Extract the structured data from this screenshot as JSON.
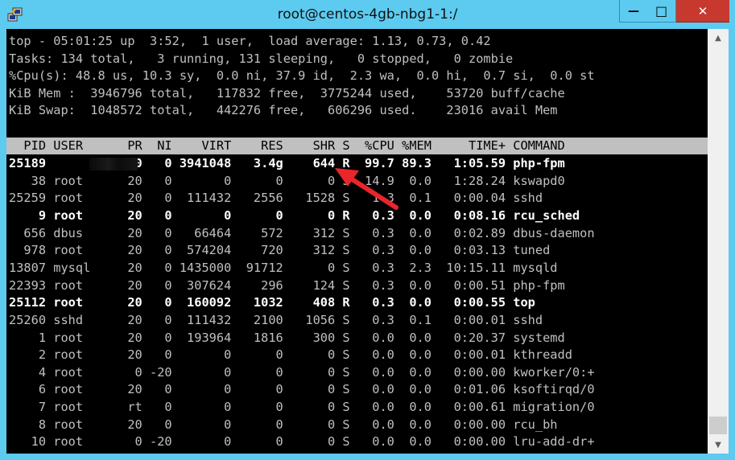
{
  "window": {
    "title": "root@centos-4gb-nbg1-1:/",
    "min_glyph": "—",
    "max_glyph": "□",
    "close_glyph": "✕"
  },
  "top_summary": [
    "top - 05:01:25 up  3:52,  1 user,  load average: 1.13, 0.73, 0.42",
    "Tasks: 134 total,   3 running, 131 sleeping,   0 stopped,   0 zombie",
    "%Cpu(s): 48.8 us, 10.3 sy,  0.0 ni, 37.9 id,  2.3 wa,  0.0 hi,  0.7 si,  0.0 st",
    "KiB Mem :  3946796 total,   117832 free,  3775244 used,    53720 buff/cache",
    "KiB Swap:  1048572 total,   442276 free,   606296 used.    23016 avail Mem"
  ],
  "process_header": "  PID USER      PR  NI    VIRT    RES    SHR S  %CPU %MEM     TIME+ COMMAND",
  "processes": [
    {
      "text": "25189           20   0 3941048   3.4g    644 R  99.7 89.3   1:05.59 php-fpm",
      "bold": true
    },
    {
      "text": "   38 root      20   0       0      0      0 S  14.9  0.0   1:28.24 kswapd0",
      "bold": false
    },
    {
      "text": "25259 root      20   0  111432   2556   1528 S   1.3  0.1   0:00.04 sshd",
      "bold": false
    },
    {
      "text": "    9 root      20   0       0      0      0 R   0.3  0.0   0:08.16 rcu_sched",
      "bold": true
    },
    {
      "text": "  656 dbus      20   0   66464    572    312 S   0.3  0.0   0:02.89 dbus-daemon",
      "bold": false
    },
    {
      "text": "  978 root      20   0  574204    720    312 S   0.3  0.0   0:03.13 tuned",
      "bold": false
    },
    {
      "text": "13807 mysql     20   0 1435000  91712      0 S   0.3  2.3  10:15.11 mysqld",
      "bold": false
    },
    {
      "text": "22393 root      20   0  307624    296    124 S   0.3  0.0   0:00.51 php-fpm",
      "bold": false
    },
    {
      "text": "25112 root      20   0  160092   1032    408 R   0.3  0.0   0:00.55 top",
      "bold": true
    },
    {
      "text": "25260 sshd      20   0  111432   2100   1056 S   0.3  0.1   0:00.01 sshd",
      "bold": false
    },
    {
      "text": "    1 root      20   0  193964   1816    300 S   0.0  0.0   0:20.37 systemd",
      "bold": false
    },
    {
      "text": "    2 root      20   0       0      0      0 S   0.0  0.0   0:00.01 kthreadd",
      "bold": false
    },
    {
      "text": "    4 root       0 -20       0      0      0 S   0.0  0.0   0:00.00 kworker/0:+",
      "bold": false
    },
    {
      "text": "    6 root      20   0       0      0      0 S   0.0  0.0   0:01.06 ksoftirqd/0",
      "bold": false
    },
    {
      "text": "    7 root      rt   0       0      0      0 S   0.0  0.0   0:00.61 migration/0",
      "bold": false
    },
    {
      "text": "    8 root      20   0       0      0      0 S   0.0  0.0   0:00.00 rcu_bh",
      "bold": false
    },
    {
      "text": "   10 root       0 -20       0      0      0 S   0.0  0.0   0:00.00 lru-add-dr+",
      "bold": false
    }
  ],
  "scrollbar": {
    "up": "▲",
    "down": "▼"
  },
  "colors": {
    "annotation_arrow": "#e8262b",
    "titlebar": "#5ccbef",
    "close_button": "#c7382f"
  }
}
